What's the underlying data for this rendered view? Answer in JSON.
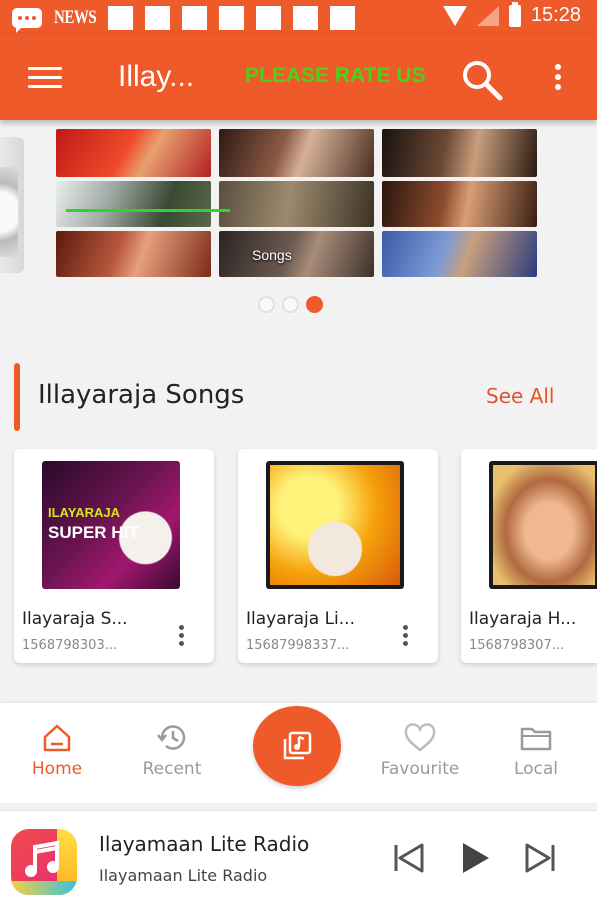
{
  "status_bar": {
    "carrier_label": "NEWS",
    "time": "15:28",
    "icons": [
      "message-icon",
      "news-icon",
      "notification-square-icon",
      "wifi-icon",
      "signal-icon",
      "battery-icon"
    ]
  },
  "app_bar": {
    "title": "Illay...",
    "rate_label": "PLEASE RATE US",
    "icons": [
      "menu-icon",
      "search-icon",
      "more-vert-icon"
    ]
  },
  "banner": {
    "overlay_text": "Songs",
    "page_count": 3,
    "active_page": 3
  },
  "section": {
    "title": "Illayaraja Songs",
    "see_all_label": "See All"
  },
  "albums": [
    {
      "title": "Ilayaraja S...",
      "subtitle": "1568798303...",
      "art_line1": "ILAYARAJA",
      "art_line2": "SUPER HIT"
    },
    {
      "title": "Ilayaraja Li...",
      "subtitle": "15687998337...",
      "art_line1": "",
      "art_line2": ""
    },
    {
      "title": "Ilayaraja H...",
      "subtitle": "1568798307...",
      "art_line1": "",
      "art_line2": ""
    }
  ],
  "bottom_nav": {
    "items": [
      {
        "label": "Home",
        "icon": "home-icon",
        "active": true
      },
      {
        "label": "Recent",
        "icon": "history-icon",
        "active": false
      },
      {
        "label": "Favourite",
        "icon": "heart-icon",
        "active": false
      },
      {
        "label": "Local",
        "icon": "folder-icon",
        "active": false
      }
    ],
    "fab_icon": "music-library-icon"
  },
  "player": {
    "title": "Ilayamaan Lite Radio",
    "subtitle": "Ilayamaan Lite Radio",
    "icons": [
      "previous-icon",
      "play-icon",
      "next-icon"
    ]
  },
  "colors": {
    "accent": "#ee5a2a",
    "rate_green": "#48d21a",
    "nav_inactive": "#9a9a9a"
  }
}
